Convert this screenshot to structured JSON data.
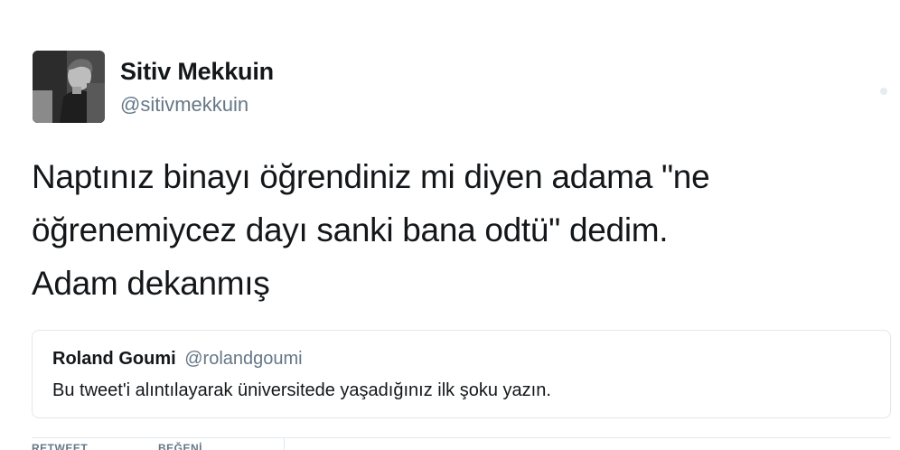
{
  "author": {
    "display_name": "Sitiv Mekkuin",
    "handle": "@sitivmekkuin"
  },
  "tweet": {
    "lines": [
      "Naptınız binayı öğrendiniz mi diyen adama \"ne",
      "öğrenemiycez dayı sanki bana odtü\" dedim.",
      "Adam dekanmış"
    ]
  },
  "quoted_tweet": {
    "author_name": "Roland Goumi",
    "author_handle": "@rolandgoumi",
    "text": "Bu tweet'i alıntılayarak üniversitede yaşadığınız ilk şoku yazın."
  },
  "stats": {
    "retweets_label": "RETWEET",
    "likes_label": "BEĞENİ"
  },
  "icons": {
    "more": "more-dot-icon"
  },
  "colors": {
    "text_primary": "#14171a",
    "text_secondary": "#657786",
    "border": "#e1e8ed"
  }
}
